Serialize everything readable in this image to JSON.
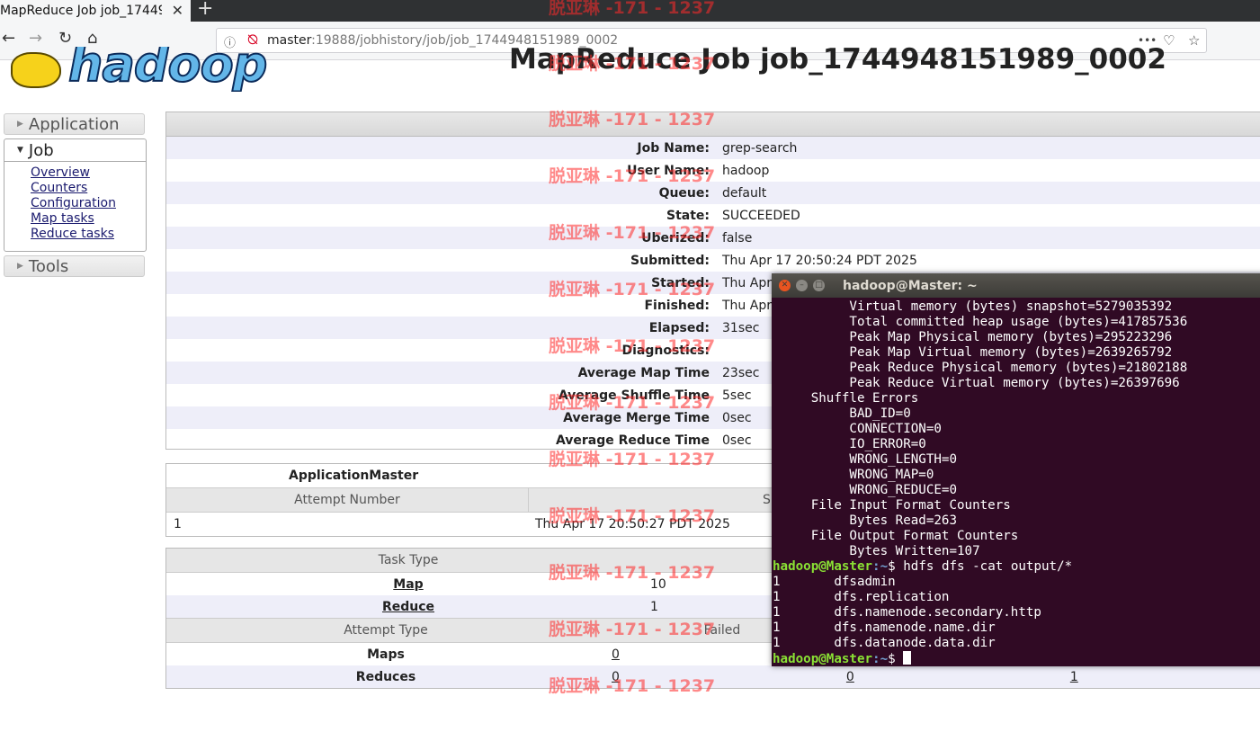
{
  "browser": {
    "tab_title": "MapReduce Job job_17449",
    "tab_close": "✕",
    "new_tab": "+",
    "url_host": "master",
    "url_rest": ":19888/jobhistory/job/job_1744948151989_0002",
    "more_icon": "•••"
  },
  "page": {
    "title": "MapReduce Job job_1744948151989_0002",
    "logo_text": "hadoop"
  },
  "sidebar": {
    "application": "Application",
    "job": "Job",
    "job_links": [
      "Overview",
      "Counters",
      "Configuration",
      "Map tasks",
      "Reduce tasks"
    ],
    "tools": "Tools"
  },
  "job_info": [
    {
      "key": "Job Name:",
      "value": "grep-search"
    },
    {
      "key": "User Name:",
      "value": "hadoop"
    },
    {
      "key": "Queue:",
      "value": "default"
    },
    {
      "key": "State:",
      "value": "SUCCEEDED"
    },
    {
      "key": "Uberized:",
      "value": "false"
    },
    {
      "key": "Submitted:",
      "value": "Thu Apr 17 20:50:24 PDT 2025"
    },
    {
      "key": "Started:",
      "value": "Thu Apr"
    },
    {
      "key": "Finished:",
      "value": "Thu Apr"
    },
    {
      "key": "Elapsed:",
      "value": "31sec"
    },
    {
      "key": "Diagnostics:",
      "value": ""
    },
    {
      "key": "Average Map Time",
      "value": "23sec"
    },
    {
      "key": "Average Shuffle Time",
      "value": "5sec"
    },
    {
      "key": "Average Merge Time",
      "value": "0sec"
    },
    {
      "key": "Average Reduce Time",
      "value": "0sec"
    }
  ],
  "application_master": {
    "title": "ApplicationMaster",
    "col_attempt": "Attempt Number",
    "col_start": "S",
    "attempt": "1",
    "start_time": "Thu Apr 17 20:50:27 PDT 2025"
  },
  "tasks": {
    "col_task_type": "Task Type",
    "map_label": "Map",
    "map_total": "10",
    "reduce_label": "Reduce",
    "reduce_total": "1",
    "col_attempt_type": "Attempt Type",
    "col_failed": "Failed",
    "maps_label": "Maps",
    "maps_failed": "0",
    "reduces_label": "Reduces",
    "reduces_failed": "0",
    "reduces_killed": "0",
    "reduces_successful": "1"
  },
  "terminal": {
    "title": "hadoop@Master: ~",
    "lines": [
      "          Virtual memory (bytes) snapshot=5279035392",
      "          Total committed heap usage (bytes)=417857536",
      "          Peak Map Physical memory (bytes)=295223296",
      "          Peak Map Virtual memory (bytes)=2639265792",
      "          Peak Reduce Physical memory (bytes)=21802188",
      "          Peak Reduce Virtual memory (bytes)=26397696",
      "     Shuffle Errors",
      "          BAD_ID=0",
      "          CONNECTION=0",
      "          IO_ERROR=0",
      "          WRONG_LENGTH=0",
      "          WRONG_MAP=0",
      "          WRONG_REDUCE=0",
      "     File Input Format Counters",
      "          Bytes Read=263",
      "     File Output Format Counters",
      "          Bytes Written=107"
    ],
    "prompt_user": "hadoop@Master",
    "prompt_path": ":~",
    "prompt_sym": "$ ",
    "command": "hdfs dfs -cat output/*",
    "output": [
      "1       dfsadmin",
      "1       dfs.replication",
      "1       dfs.namenode.secondary.http",
      "1       dfs.namenode.name.dir",
      "1       dfs.datanode.data.dir"
    ]
  },
  "watermark": "脱亚琳 -171 - 1237"
}
